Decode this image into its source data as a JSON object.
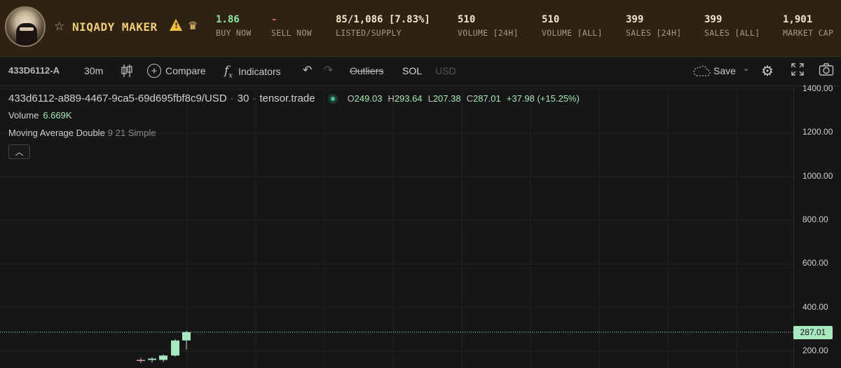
{
  "header": {
    "collection_name": "NIQADY MAKER",
    "warning_icon": "warning-triangle-icon",
    "crown_icon": "crown-icon",
    "star_icon": "star-outline-icon",
    "stats": [
      {
        "value": "1.86",
        "label": "BUY NOW",
        "color": "#8ee6a2"
      },
      {
        "value": "-",
        "label": "SELL NOW",
        "color": "#f06060"
      },
      {
        "value": "85/1,086 [7.83%]",
        "label": "LISTED/SUPPLY"
      },
      {
        "value": "510",
        "label": "VOLUME [24H]"
      },
      {
        "value": "510",
        "label": "VOLUME [ALL]"
      },
      {
        "value": "399",
        "label": "SALES [24H]"
      },
      {
        "value": "399",
        "label": "SALES [ALL]"
      },
      {
        "value": "1,901",
        "label": "MARKET CAP"
      }
    ]
  },
  "toolbar": {
    "symbol": "433D6112-A",
    "interval": "30m",
    "compare": "Compare",
    "indicators": "Indicators",
    "outliers": "Outliers",
    "sol": "SOL",
    "usd": "USD",
    "save": "Save"
  },
  "legend": {
    "symbol_full": "433d6112-a889-4467-9ca5-69d695fbf8c9/USD",
    "interval": "30",
    "source": "tensor.trade",
    "o_label": "O",
    "o": "249.03",
    "h_label": "H",
    "h": "293.64",
    "l_label": "L",
    "l": "207.38",
    "c_label": "C",
    "c": "287.01",
    "change": "+37.98 (+15.25%)",
    "volume_label": "Volume",
    "volume_value": "6.669K",
    "ma_label": "Moving Average Double",
    "ma_params": "9 21 Simple"
  },
  "chart_data": {
    "type": "candlestick",
    "y_ticks": [
      "1400.00",
      "1200.00",
      "1000.00",
      "800.00",
      "600.00",
      "400.00",
      "200.00"
    ],
    "ylim": [
      140,
      1400
    ],
    "last_price": "287.01",
    "candles": [
      {
        "o": 158,
        "h": 170,
        "l": 145,
        "c": 160
      },
      {
        "o": 160,
        "h": 172,
        "l": 148,
        "c": 166
      },
      {
        "o": 160,
        "h": 185,
        "l": 150,
        "c": 180
      },
      {
        "o": 180,
        "h": 255,
        "l": 175,
        "c": 249
      },
      {
        "o": 249.03,
        "h": 293.64,
        "l": 207.38,
        "c": 287.01
      }
    ],
    "up_color": "#a8e8c0",
    "down_color": "#e8a0b0"
  }
}
